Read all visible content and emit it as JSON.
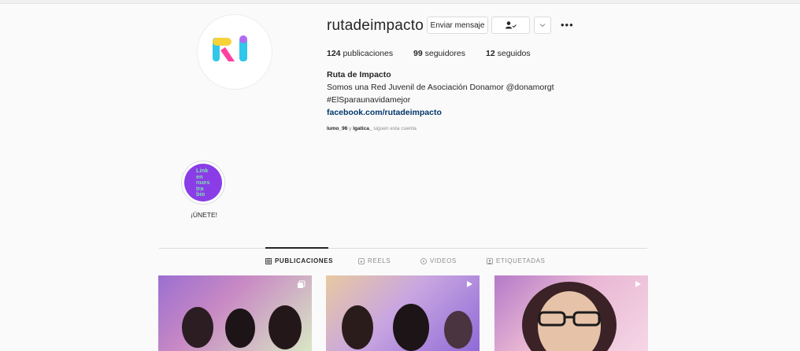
{
  "profile": {
    "username": "rutadeimpacto",
    "message_button": "Enviar mensaje",
    "follow_icon": "user-check-icon",
    "chevron_icon": "chevron-down-icon",
    "more_icon": "more-dots-icon",
    "more_label": "•••",
    "stats": {
      "posts_count": "124",
      "posts_label": " publicaciones",
      "followers_count": "99",
      "followers_label": " seguidores",
      "following_count": "12",
      "following_label": " seguidos"
    },
    "bio": {
      "name": "Ruta de Impacto",
      "line1": "Somos una Red Juvenil de Asociación Donamor @donamorgt",
      "line2": "#ElSparaunavidamejor",
      "link": "facebook.com/rutadeimpacto"
    },
    "followed_by": {
      "user1": "lumo_96",
      "joiner": " y ",
      "user2": "lgatica_",
      "suffix": " siguen esta cuenta"
    }
  },
  "highlight": {
    "cover_text": "Link en nues tra bio",
    "label": "¡ÚNETE!"
  },
  "tabs": [
    {
      "label": "PUBLICACIONES",
      "icon": "grid-icon",
      "active": true
    },
    {
      "label": "REELS",
      "icon": "reels-icon",
      "active": false
    },
    {
      "label": "VIDEOS",
      "icon": "video-icon",
      "active": false
    },
    {
      "label": "ETIQUETADAS",
      "icon": "tagged-icon",
      "active": false
    }
  ],
  "posts": [
    {
      "type_icon": "carousel-icon"
    },
    {
      "type_icon": "video-play-icon"
    },
    {
      "type_icon": "video-play-icon"
    }
  ],
  "colors": {
    "accent_purple": "#8a3de6",
    "link_blue": "#00376b",
    "muted_gray": "#8e8e8e"
  }
}
